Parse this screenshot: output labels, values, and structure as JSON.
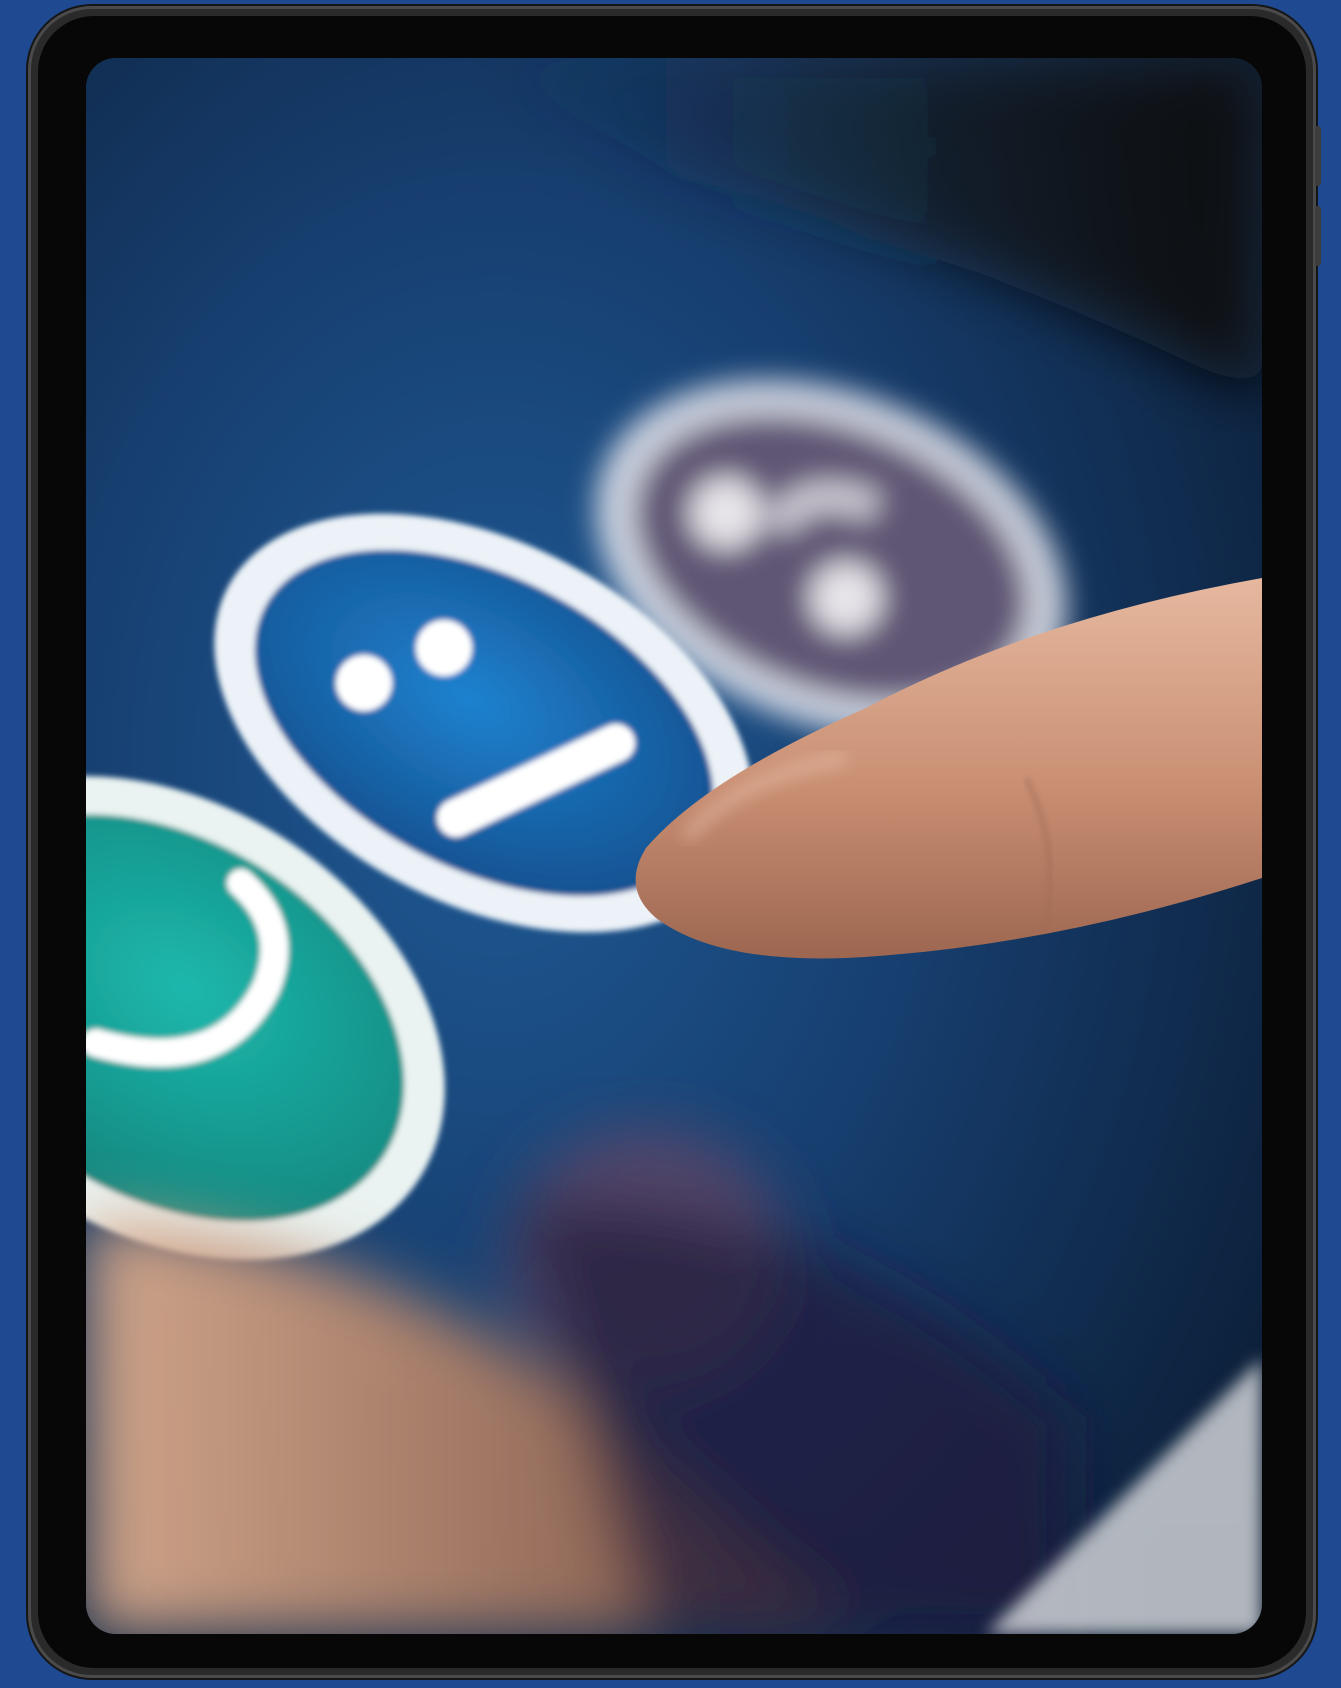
{
  "scene": {
    "description_icons": [
      "smile-face-icon",
      "neutral-face-icon",
      "sad-face-icon"
    ],
    "colors": {
      "background": "#1f4a92",
      "screen": "#123a66",
      "smile": "#1aa59a",
      "neutral": "#1d6fb3",
      "sad": "#6a5a78",
      "finger": "#d8a488"
    }
  }
}
